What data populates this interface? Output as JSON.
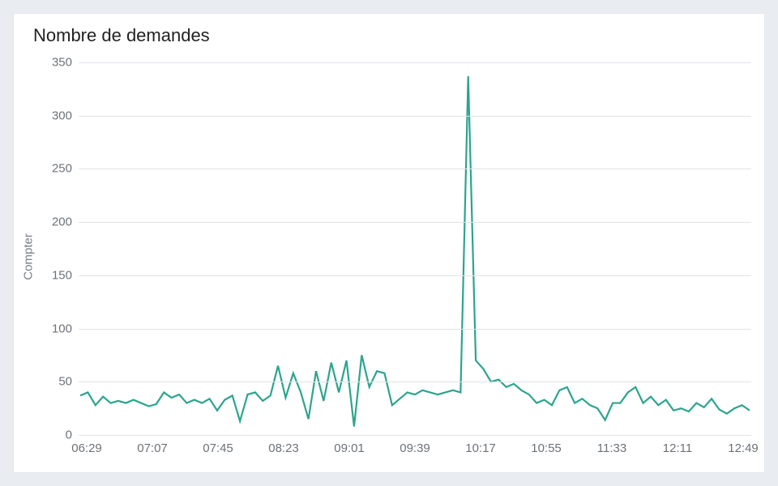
{
  "chart_data": {
    "type": "line",
    "title": "Nombre de demandes",
    "ylabel": "Compter",
    "xlabel": "",
    "ylim": [
      0,
      350
    ],
    "y_ticks": [
      0,
      50,
      100,
      150,
      200,
      250,
      300,
      350
    ],
    "x_tick_labels": [
      "06:29",
      "07:07",
      "07:45",
      "08:23",
      "09:01",
      "09:39",
      "10:17",
      "10:55",
      "11:33",
      "12:11",
      "12:49"
    ],
    "series": [
      {
        "name": "Compter",
        "color": "#2ca58d",
        "values": [
          37,
          40,
          28,
          36,
          30,
          32,
          30,
          33,
          30,
          27,
          29,
          40,
          35,
          38,
          30,
          33,
          30,
          34,
          23,
          33,
          37,
          13,
          38,
          40,
          32,
          37,
          65,
          35,
          58,
          40,
          15,
          60,
          32,
          68,
          40,
          70,
          8,
          75,
          45,
          60,
          58,
          28,
          34,
          40,
          38,
          42,
          40,
          38,
          40,
          42,
          40,
          337,
          70,
          62,
          50,
          52,
          45,
          48,
          42,
          38,
          30,
          33,
          28,
          42,
          45,
          30,
          34,
          28,
          25,
          14,
          30,
          30,
          40,
          45,
          30,
          36,
          28,
          33,
          23,
          25,
          22,
          30,
          26,
          34,
          24,
          20,
          25,
          28,
          23
        ]
      }
    ]
  }
}
